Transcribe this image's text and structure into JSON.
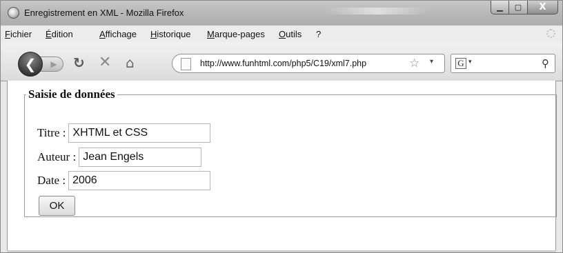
{
  "window": {
    "title": "Enregistrement en XML - Mozilla Firefox",
    "app_icon": "firefox-icon",
    "controls": {
      "minimize": "▁",
      "maximize": "▢",
      "close": "X"
    }
  },
  "menu": {
    "items": [
      "Fichier",
      "Édition",
      "Affichage",
      "Historique",
      "Marque-pages",
      "Outils",
      "?"
    ]
  },
  "nav": {
    "back_icon": "back-arrow-icon",
    "forward_icon": "forward-arrow-icon",
    "reload_icon": "reload-icon",
    "stop_icon": "stop-icon",
    "home_icon": "home-icon"
  },
  "address": {
    "url": "http://www.funhtml.com/php5/C19/xml7.php",
    "bookmark_icon": "star-icon"
  },
  "search": {
    "engine_icon": "google-icon",
    "value": ""
  },
  "form": {
    "legend": "Saisie de données",
    "fields": [
      {
        "label": "Titre :",
        "value": "XHTML et CSS"
      },
      {
        "label": "Auteur :",
        "value": "Jean Engels"
      },
      {
        "label": "Date :",
        "value": "2006"
      }
    ],
    "submit_label": "OK"
  }
}
